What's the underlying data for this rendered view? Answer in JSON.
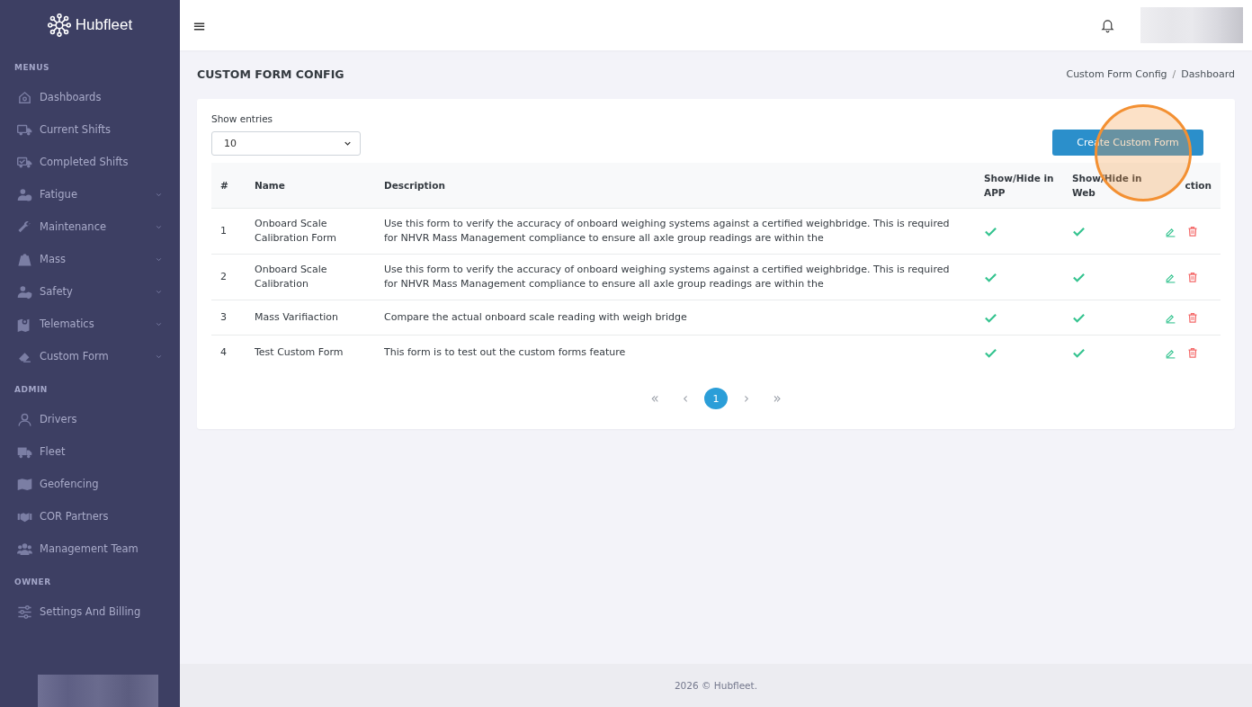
{
  "brand": {
    "name": "Hubfleet"
  },
  "sidebar": {
    "sections": [
      {
        "heading": "MENUS",
        "items": [
          {
            "label": "Dashboards",
            "has_submenu": false
          },
          {
            "label": "Current Shifts",
            "has_submenu": false
          },
          {
            "label": "Completed Shifts",
            "has_submenu": false
          },
          {
            "label": "Fatigue",
            "has_submenu": true
          },
          {
            "label": "Maintenance",
            "has_submenu": true
          },
          {
            "label": "Mass",
            "has_submenu": true
          },
          {
            "label": "Safety",
            "has_submenu": true
          },
          {
            "label": "Telematics",
            "has_submenu": true
          },
          {
            "label": "Custom Form",
            "has_submenu": true
          }
        ]
      },
      {
        "heading": "ADMIN",
        "items": [
          {
            "label": "Drivers",
            "has_submenu": false
          },
          {
            "label": "Fleet",
            "has_submenu": false
          },
          {
            "label": "Geofencing",
            "has_submenu": false
          },
          {
            "label": "COR Partners",
            "has_submenu": false
          },
          {
            "label": "Management Team",
            "has_submenu": false
          }
        ]
      },
      {
        "heading": "OWNER",
        "items": [
          {
            "label": "Settings And Billing",
            "has_submenu": false
          }
        ]
      }
    ]
  },
  "topbar": {
    "menu_glyph": "≡"
  },
  "page": {
    "title": "CUSTOM FORM CONFIG",
    "breadcrumb": [
      {
        "label": "Custom Form Config"
      },
      {
        "label": "Dashboard"
      }
    ],
    "breadcrumb_separator": "/"
  },
  "card": {
    "entries_label": "Show entries",
    "entries_value": "10",
    "create_button": "Create Custom Form",
    "table": {
      "columns": [
        "#",
        "Name",
        "Description",
        "Show/Hide in APP",
        "Show/Hide in Web",
        "ction"
      ],
      "rows": [
        {
          "index": "1",
          "name": "Onboard Scale Calibration Form",
          "description": "Use this form to verify the accuracy of onboard weighing systems against a certified weighbridge. This is required for NHVR Mass Management compliance to ensure all axle group readings are within the",
          "in_app": true,
          "in_web": true
        },
        {
          "index": "2",
          "name": "Onboard Scale Calibration",
          "description": "Use this form to verify the accuracy of onboard weighing systems against a certified weighbridge. This is required for NHVR Mass Management compliance to ensure all axle group readings are within the",
          "in_app": true,
          "in_web": true
        },
        {
          "index": "3",
          "name": "Mass Varifiaction",
          "description": "Compare the actual onboard scale reading with weigh bridge",
          "in_app": true,
          "in_web": true
        },
        {
          "index": "4",
          "name": "Test Custom Form",
          "description": "This form is to test out the custom forms feature",
          "in_app": true,
          "in_web": true
        }
      ]
    },
    "pagination": [
      {
        "label": "«",
        "kind": "nav",
        "disabled": true,
        "selected": false
      },
      {
        "label": "‹",
        "kind": "nav",
        "disabled": true,
        "selected": false
      },
      {
        "label": "1",
        "kind": "page",
        "disabled": false,
        "selected": true
      },
      {
        "label": "›",
        "kind": "nav",
        "disabled": true,
        "selected": false
      },
      {
        "label": "»",
        "kind": "nav",
        "disabled": true,
        "selected": false
      }
    ]
  },
  "click_highlight": true,
  "footer": {
    "text": "2026 © Hubfleet."
  }
}
